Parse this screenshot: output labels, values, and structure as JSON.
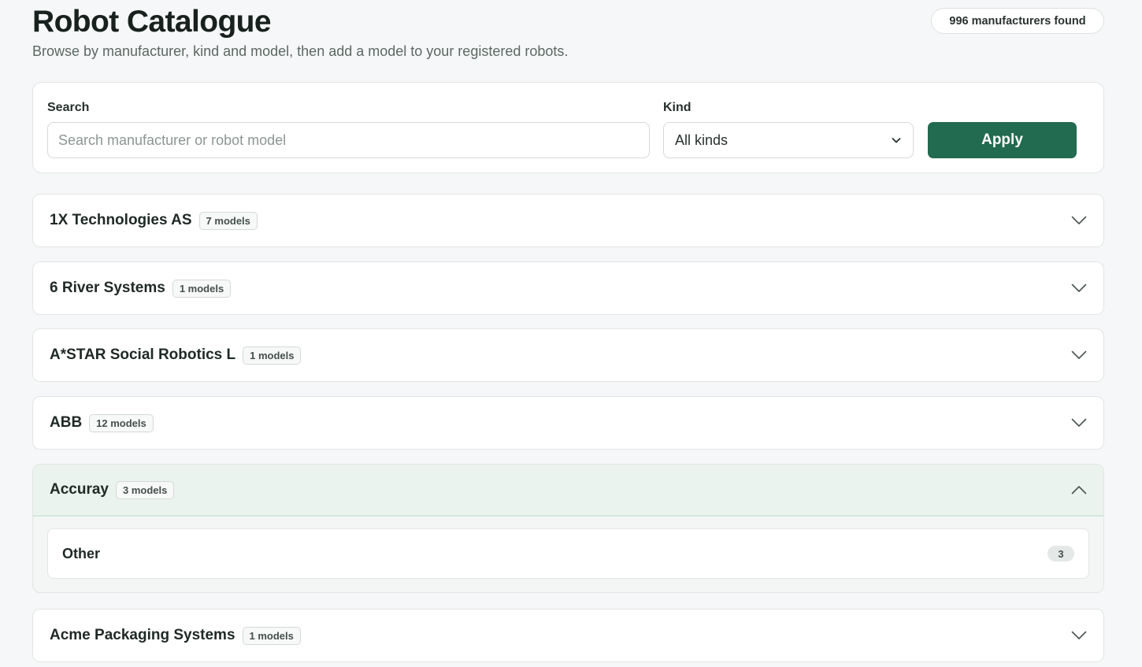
{
  "header": {
    "title": "Robot Catalogue",
    "subtitle": "Browse by manufacturer, kind and model, then add a model to your registered robots.",
    "count_label": "996 manufacturers found"
  },
  "filters": {
    "search_label": "Search",
    "search_placeholder": "Search manufacturer or robot model",
    "search_value": "",
    "kind_label": "Kind",
    "kind_value": "All kinds",
    "apply_label": "Apply"
  },
  "manufacturers": [
    {
      "name": "1X Technologies AS",
      "models_label": "7 models",
      "expanded": false
    },
    {
      "name": "6 River Systems",
      "models_label": "1 models",
      "expanded": false
    },
    {
      "name": "A*STAR Social Robotics L",
      "models_label": "1 models",
      "expanded": false
    },
    {
      "name": "ABB",
      "models_label": "12 models",
      "expanded": false
    },
    {
      "name": "Accuray",
      "models_label": "3 models",
      "expanded": true,
      "kinds": [
        {
          "name": "Other",
          "count": "3"
        }
      ]
    },
    {
      "name": "Acme Packaging Systems",
      "models_label": "1 models",
      "expanded": false
    }
  ],
  "colors": {
    "accent": "#226a50",
    "page_bg": "#f6f7f8",
    "expanded_header_bg": "#ebf3ef"
  },
  "icons": {
    "collapsed": "chevron-down-icon",
    "expanded": "chevron-up-icon",
    "select": "chevron-down-icon"
  }
}
